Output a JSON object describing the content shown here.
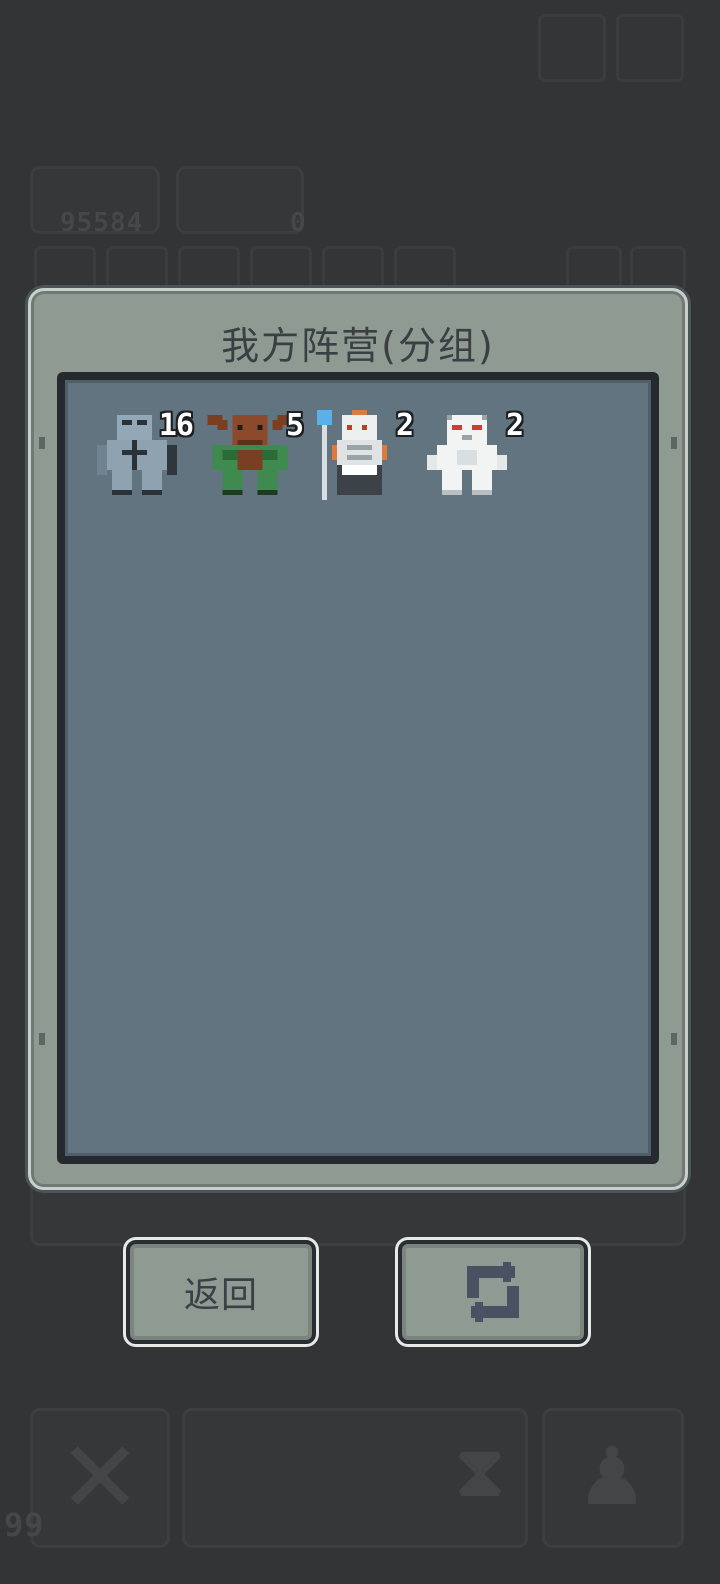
{
  "background": {
    "gold_amount": "95584",
    "gem_amount": "0",
    "bottom_counter": "99"
  },
  "panel": {
    "title": "我方阵营(分组)",
    "units": [
      {
        "name": "stone-golem",
        "count": "16"
      },
      {
        "name": "minotaur",
        "count": "5"
      },
      {
        "name": "skeleton-mage",
        "count": "2"
      },
      {
        "name": "white-yeti",
        "count": "2"
      }
    ]
  },
  "buttons": {
    "back_label": "返回",
    "swap_icon": "swap-arrows-icon"
  },
  "colors": {
    "background": "#333435",
    "panel": "#8f9a92",
    "panel_inner": "#627480",
    "button_text": "#3b4047"
  }
}
